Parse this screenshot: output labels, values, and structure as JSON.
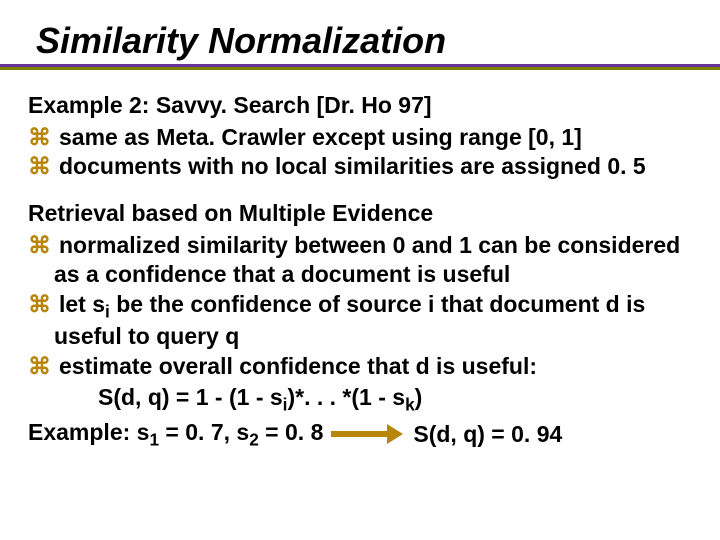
{
  "title": "Similarity Normalization",
  "section1": {
    "heading": "Example 2: Savvy. Search [Dr. Ho 97]",
    "items": [
      "same as Meta. Crawler except using range [0, 1]",
      "documents with no local similarities are assigned 0. 5"
    ]
  },
  "section2": {
    "heading": "Retrieval based on Multiple Evidence",
    "items": [
      "normalized similarity between 0 and 1 can be considered as a confidence that a document is useful",
      "let s<sub>i</sub> be the confidence of source i that document d is useful to query q",
      "estimate overall confidence that d is useful:"
    ],
    "formula": "S(d, q) = 1 - (1 - s<sub>i</sub>)*. . . *(1 - s<sub>k</sub>)",
    "example_left": "Example: s<sub>1</sub> = 0. 7, s<sub>2</sub> = 0. 8",
    "example_right": "S(d, q) = 0. 94"
  }
}
